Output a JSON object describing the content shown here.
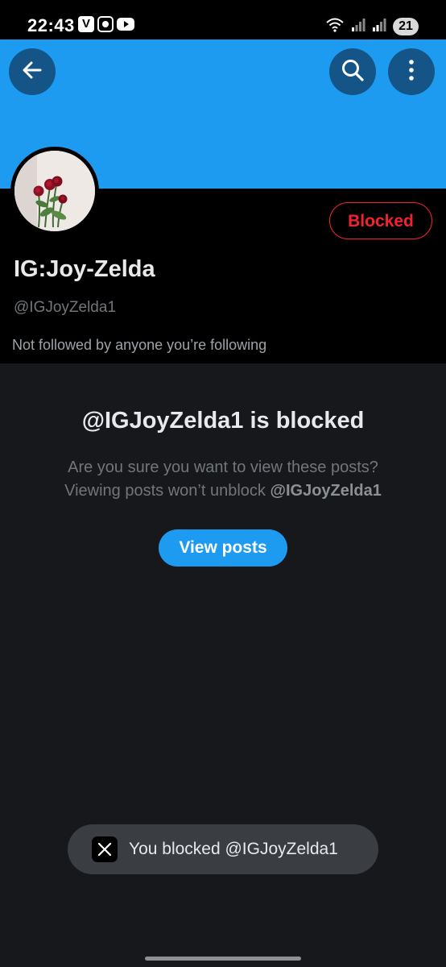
{
  "status_bar": {
    "time": "22:43",
    "left_icons": [
      "v-app-icon",
      "screen-record-icon",
      "youtube-icon"
    ],
    "v_icon_letter": "V",
    "right_icons": [
      "wifi-icon",
      "signal-icon",
      "signal-icon"
    ],
    "battery": "21"
  },
  "banner": {
    "color": "#1d9bf0",
    "buttons": [
      "back-arrow-icon",
      "search-icon",
      "more-vertical-icon"
    ]
  },
  "profile": {
    "display_name": "IG:Joy-Zelda",
    "handle": "@IGJoyZelda1",
    "follow_info": "Not followed by anyone you’re following",
    "blocked_label": "Blocked",
    "avatar": "roses-avatar"
  },
  "blocked_notice": {
    "title": "@IGJoyZelda1 is blocked",
    "line1": "Are you sure you want to view these posts?",
    "line2_prefix": "Viewing posts won’t unblock",
    "line2_handle": "@IGJoyZelda1",
    "view_posts_label": "View posts"
  },
  "toast": {
    "icon": "x-logo-icon",
    "text": "You blocked @IGJoyZelda1"
  },
  "colors": {
    "accent": "#1d9bf0",
    "blocked_red": "#f4212e",
    "background": "#16181c",
    "header_bg": "#000000"
  }
}
